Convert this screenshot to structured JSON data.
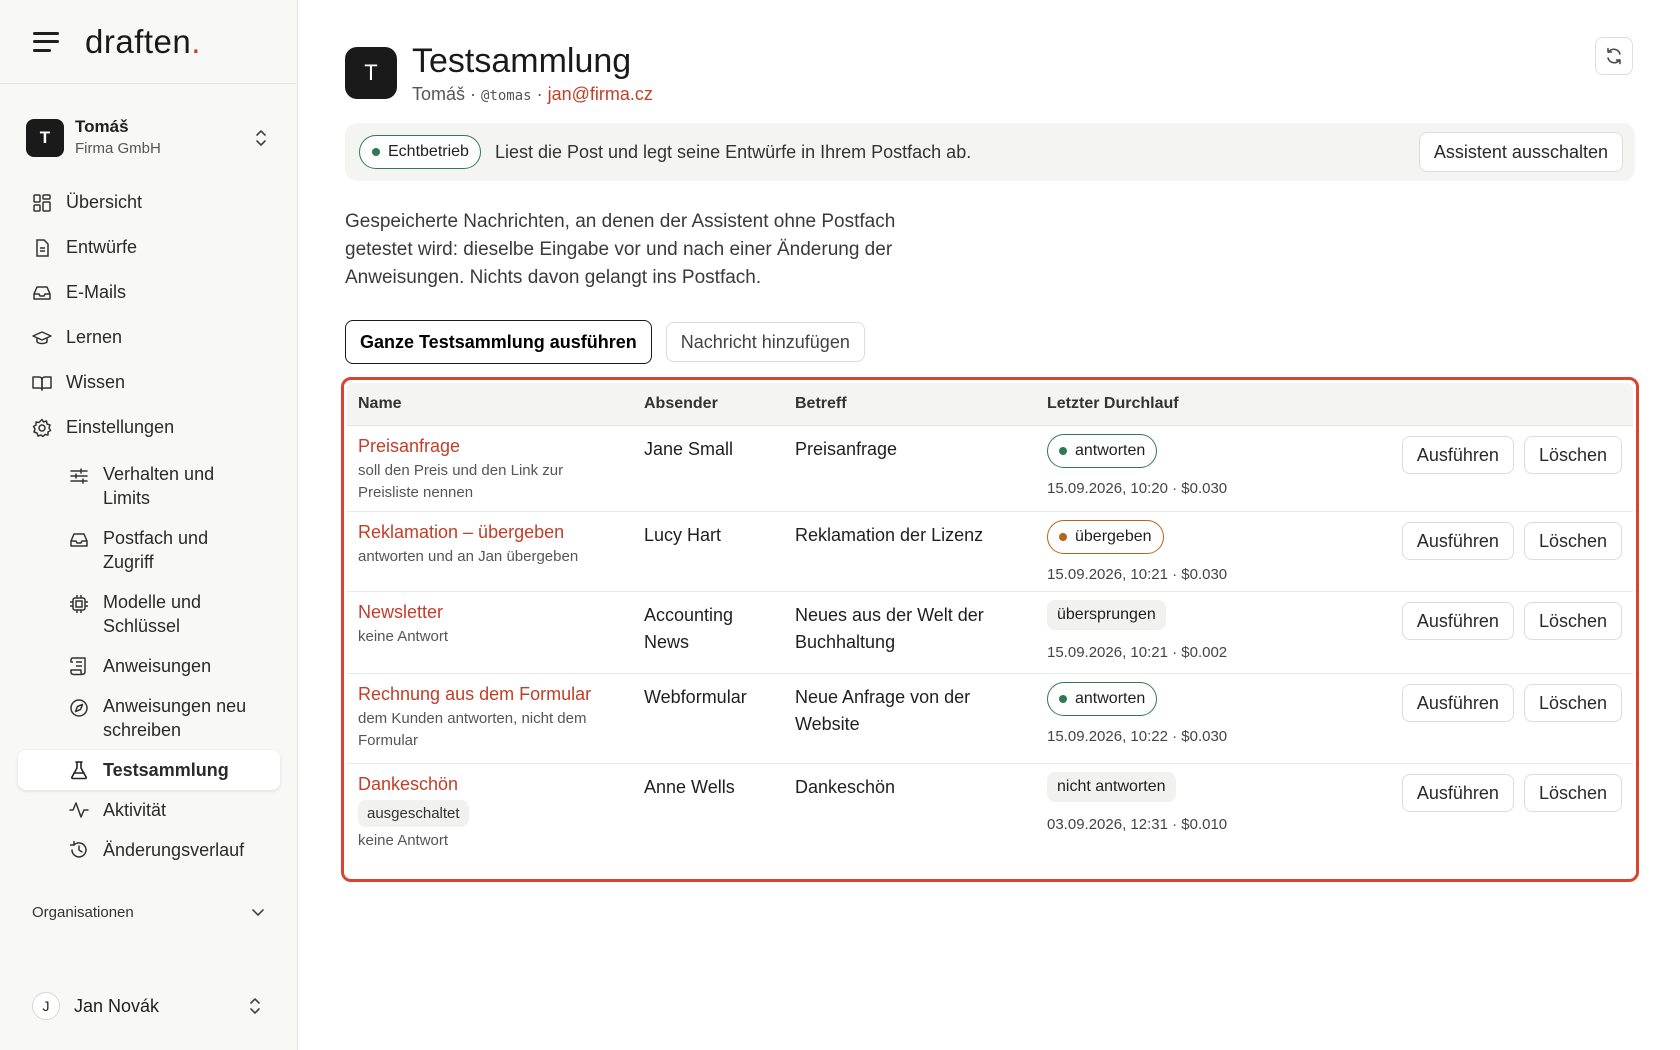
{
  "brand": {
    "logo_text": "draften",
    "logo_dot": "."
  },
  "account": {
    "initial": "T",
    "name": "Tomáš",
    "org": "Firma GmbH"
  },
  "nav": {
    "items": [
      {
        "label": "Übersicht"
      },
      {
        "label": "Entwürfe"
      },
      {
        "label": "E-Mails"
      },
      {
        "label": "Lernen"
      },
      {
        "label": "Wissen"
      },
      {
        "label": "Einstellungen"
      }
    ],
    "sub_items": [
      {
        "label": "Verhalten und Limits"
      },
      {
        "label": "Postfach und Zugriff"
      },
      {
        "label": "Modelle und Schlüssel"
      },
      {
        "label": "Anweisungen"
      },
      {
        "label": "Anweisungen neu schreiben"
      },
      {
        "label": "Testsammlung",
        "active": true
      },
      {
        "label": "Aktivität"
      },
      {
        "label": "Änderungsverlauf"
      }
    ],
    "org_section": "Organisationen"
  },
  "user": {
    "initial": "J",
    "name": "Jan Novák"
  },
  "header": {
    "initial": "T",
    "title": "Testsammlung",
    "name": "Tomáš",
    "sep1": " · ",
    "handle": "@tomas",
    "sep2": " · ",
    "email": "jan@firma.cz"
  },
  "banner": {
    "badge": "Echtbetrieb",
    "text": "Liest die Post und legt seine Entwürfe in Ihrem Postfach ab.",
    "button": "Assistent ausschalten"
  },
  "description": "Gespeicherte Nachrichten, an denen der Assistent ohne Postfach getestet wird: dieselbe Eingabe vor und nach einer Änderung der Anweisungen. Nichts davon gelangt ins Postfach.",
  "actions": {
    "run_all": "Ganze Testsammlung ausführen",
    "add_message": "Nachricht hinzufügen"
  },
  "table": {
    "headers": {
      "name": "Name",
      "sender": "Absender",
      "subject": "Betreff",
      "last_run": "Letzter Durchlauf"
    },
    "run_label": "Ausführen",
    "delete_label": "Löschen",
    "rows": [
      {
        "name": "Preisanfrage",
        "note": "soll den Preis und den Link zur Preisliste nennen",
        "sender": "Jane Small",
        "subject": "Preisanfrage",
        "status": "antworten",
        "status_color": "#2f7a55",
        "run": "15.09.2026, 10:20 · $0.030"
      },
      {
        "name": "Reklamation – übergeben",
        "note": "antworten und an Jan übergeben",
        "sender": "Lucy Hart",
        "subject": "Reklamation der Lizenz",
        "status": "übergeben",
        "status_color": "#b5651d",
        "run": "15.09.2026, 10:21 · $0.030"
      },
      {
        "name": "Newsletter",
        "note": "keine Antwort",
        "sender": "Accounting News",
        "subject": "Neues aus der Welt der Buchhaltung",
        "status": "übersprungen",
        "run": "15.09.2026, 10:21 · $0.002"
      },
      {
        "name": "Rechnung aus dem Formular",
        "note": "dem Kunden antworten, nicht dem Formular",
        "sender": "Webformular",
        "subject": "Neue Anfrage von der Website",
        "status": "antworten",
        "status_color": "#2f7a55",
        "run": "15.09.2026, 10:22 · $0.030"
      },
      {
        "name": "Dankeschön",
        "chip": "ausgeschaltet",
        "note": "keine Antwort",
        "sender": "Anne Wells",
        "subject": "Dankeschön",
        "status": "nicht antworten",
        "run": "03.09.2026, 12:31 · $0.010"
      }
    ]
  },
  "colors": {
    "accent": "#c43d28",
    "highlight_border": "#d9442e",
    "green": "#2f7a55",
    "orange": "#b5651d"
  }
}
